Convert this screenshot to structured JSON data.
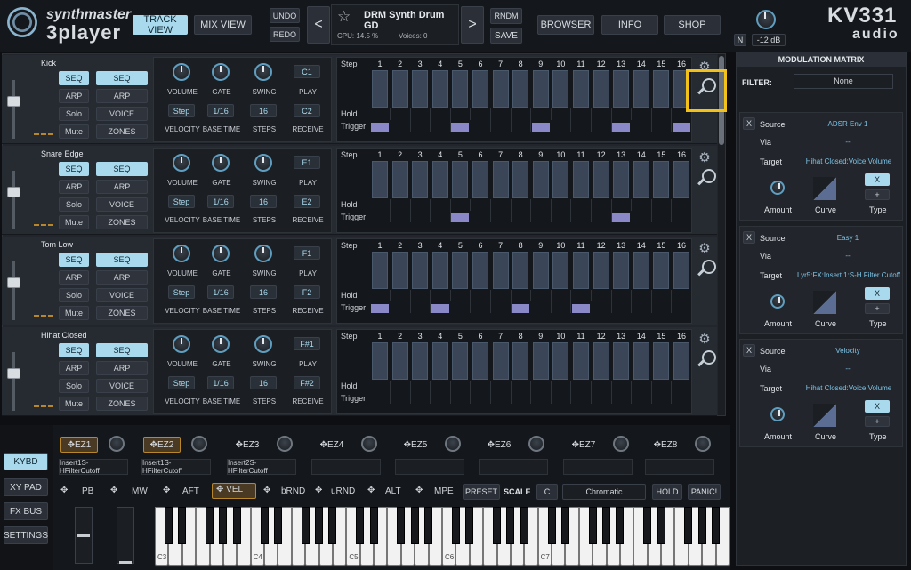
{
  "app": {
    "logo_line1": "synthmaster",
    "logo_line2": "3player",
    "brand_line1": "KV331",
    "brand_line2": "audio"
  },
  "header": {
    "track_view": "TRACK VIEW",
    "mix_view": "MIX VIEW",
    "undo": "UNDO",
    "redo": "REDO",
    "prev": "<",
    "next": ">",
    "preset_name": "DRM Synth Drum GD",
    "cpu": "CPU: 14.5 %",
    "voices": "Voices: 0",
    "rndm": "RNDM",
    "save": "SAVE",
    "browser": "BROWSER",
    "info": "INFO",
    "shop": "SHOP",
    "n": "N",
    "volume": "-12 dB"
  },
  "tracks": [
    {
      "name": "Kick",
      "seq1": "SEQ",
      "seq2": "SEQ",
      "arp": "ARP",
      "arp2": "ARP",
      "solo": "Solo",
      "voice": "VOICE",
      "mute": "Mute",
      "zones": "ZONES",
      "volume": "VOLUME",
      "gate": "GATE",
      "swing": "SWING",
      "play": "PLAY",
      "play_val": "C1",
      "velocity_val": "Step",
      "base_val": "1/16",
      "steps_val": "16",
      "receive_val": "C2",
      "velocity": "VELOCITY",
      "base_time": "BASE TIME",
      "steps": "STEPS",
      "receive": "RECEIVE",
      "triggers": [
        1,
        5,
        9,
        13,
        16
      ]
    },
    {
      "name": "Snare Edge",
      "seq1": "SEQ",
      "seq2": "SEQ",
      "arp": "ARP",
      "arp2": "ARP",
      "solo": "Solo",
      "voice": "VOICE",
      "mute": "Mute",
      "zones": "ZONES",
      "volume": "VOLUME",
      "gate": "GATE",
      "swing": "SWING",
      "play": "PLAY",
      "play_val": "E1",
      "velocity_val": "Step",
      "base_val": "1/16",
      "steps_val": "16",
      "receive_val": "E2",
      "velocity": "VELOCITY",
      "base_time": "BASE TIME",
      "steps": "STEPS",
      "receive": "RECEIVE",
      "triggers": [
        5,
        13
      ]
    },
    {
      "name": "Tom Low",
      "seq1": "SEQ",
      "seq2": "SEQ",
      "arp": "ARP",
      "arp2": "ARP",
      "solo": "Solo",
      "voice": "VOICE",
      "mute": "Mute",
      "zones": "ZONES",
      "volume": "VOLUME",
      "gate": "GATE",
      "swing": "SWING",
      "play": "PLAY",
      "play_val": "F1",
      "velocity_val": "Step",
      "base_val": "1/16",
      "steps_val": "16",
      "receive_val": "F2",
      "velocity": "VELOCITY",
      "base_time": "BASE TIME",
      "steps": "STEPS",
      "receive": "RECEIVE",
      "triggers": [
        1,
        4,
        8,
        11
      ]
    },
    {
      "name": "Hihat Closed",
      "seq1": "SEQ",
      "seq2": "SEQ",
      "arp": "ARP",
      "arp2": "ARP",
      "solo": "Solo",
      "voice": "VOICE",
      "mute": "Mute",
      "zones": "ZONES",
      "volume": "VOLUME",
      "gate": "GATE",
      "swing": "SWING",
      "play": "PLAY",
      "play_val": "F#1",
      "velocity_val": "Step",
      "base_val": "1/16",
      "steps_val": "16",
      "receive_val": "F#2",
      "velocity": "VELOCITY",
      "base_time": "BASE TIME",
      "steps": "STEPS",
      "receive": "RECEIVE",
      "triggers": []
    }
  ],
  "grid": {
    "step": "Step",
    "hold": "Hold",
    "trigger": "Trigger",
    "numbers": [
      "1",
      "2",
      "3",
      "4",
      "5",
      "6",
      "7",
      "8",
      "9",
      "10",
      "11",
      "12",
      "13",
      "14",
      "15",
      "16"
    ]
  },
  "modmatrix": {
    "title": "MODULATION MATRIX",
    "filter_label": "FILTER:",
    "filter_val": "None",
    "slots": [
      {
        "x": "X",
        "source": "Source",
        "source_val": "ADSR Env 1",
        "via": "Via",
        "via_val": "--",
        "target": "Target",
        "target_val": "Hihat Closed:Voice Volume",
        "amount": "Amount",
        "curve": "Curve",
        "type": "Type",
        "type_x": "X",
        "type_plus": "+"
      },
      {
        "x": "X",
        "source": "Source",
        "source_val": "Easy 1",
        "via": "Via",
        "via_val": "--",
        "target": "Target",
        "target_val": "Lyr5:FX:Insert 1:S-H Filter Cutoff",
        "amount": "Amount",
        "curve": "Curve",
        "type": "Type",
        "type_x": "X",
        "type_plus": "+"
      },
      {
        "x": "X",
        "source": "Source",
        "source_val": "Velocity",
        "via": "Via",
        "via_val": "--",
        "target": "Target",
        "target_val": "Hihat Closed:Voice Volume",
        "amount": "Amount",
        "curve": "Curve",
        "type": "Type",
        "type_x": "X",
        "type_plus": "+"
      }
    ]
  },
  "bottom": {
    "kybd": "KYBD",
    "xypad": "XY PAD",
    "fxbus": "FX BUS",
    "settings": "SETTINGS",
    "ez": [
      "EZ1",
      "EZ2",
      "EZ3",
      "EZ4",
      "EZ5",
      "EZ6",
      "EZ7",
      "EZ8"
    ],
    "ez_fields": [
      "Insert1S-HFilterCutoff",
      "Insert1S-HFilterCutoff",
      "Insert2S-HFilterCutoff",
      "",
      "",
      "",
      "",
      ""
    ],
    "pb": "PB",
    "mw": "MW",
    "aft": "AFT",
    "vel": "VEL",
    "brnd": "bRND",
    "urnd": "uRND",
    "alt": "ALT",
    "mpe": "MPE",
    "preset": "PRESET",
    "scale": "SCALE",
    "scale_root": "C",
    "scale_val": "Chromatic",
    "hold": "HOLD",
    "panic": "PANIC!",
    "octaves": [
      "C3",
      "C4",
      "C5",
      "C6",
      "C7"
    ]
  }
}
